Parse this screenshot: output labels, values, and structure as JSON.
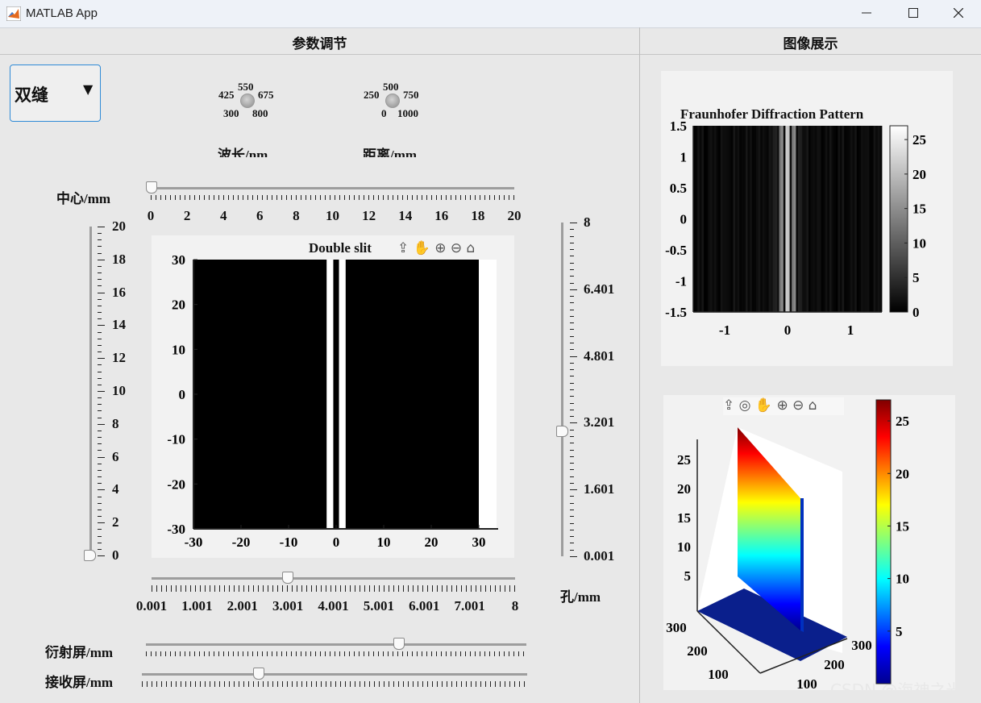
{
  "window": {
    "title": "MATLAB App"
  },
  "panels": {
    "left_title": "参数调节",
    "right_title": "图像展示"
  },
  "dropdown": {
    "value": "双缝"
  },
  "knob_wavelength": {
    "labels": [
      "425",
      "550",
      "675",
      "300",
      "800"
    ],
    "caption": "波长/nm"
  },
  "knob_distance": {
    "labels": [
      "250",
      "500",
      "750",
      "0",
      "1000"
    ],
    "caption": "距离/mm"
  },
  "slider_center": {
    "label": "中心/mm",
    "ticks": [
      "0",
      "2",
      "4",
      "6",
      "8",
      "10",
      "12",
      "14",
      "16",
      "18",
      "20"
    ],
    "value": 0
  },
  "slider_left_vertical": {
    "ticks": [
      "20",
      "18",
      "16",
      "14",
      "12",
      "10",
      "8",
      "6",
      "4",
      "2",
      "0"
    ],
    "value": 0
  },
  "slider_aperture": {
    "label": "孔/mm",
    "ticks": [
      "8",
      "6.401",
      "4.801",
      "3.201",
      "1.601",
      "0.001"
    ],
    "value": 3.2
  },
  "slider_bottom": {
    "ticks": [
      "0.001",
      "1.001",
      "2.001",
      "3.001",
      "4.001",
      "5.001",
      "6.001",
      "7.001",
      "8"
    ],
    "value": 3.0
  },
  "slider_diffraction_screen": {
    "label": "衍射屏/mm",
    "value": 0.67
  },
  "slider_receive_screen": {
    "label": "接收屏/mm",
    "value": 0.3
  },
  "toolbar_icons": [
    "export-icon",
    "pan-hand-icon",
    "zoom-in-icon",
    "zoom-out-icon",
    "home-icon"
  ],
  "chart_data": [
    {
      "type": "heatmap",
      "title": "Double slit",
      "xticks": [
        "-30",
        "-20",
        "-10",
        "0",
        "10",
        "20",
        "30"
      ],
      "yticks": [
        "30",
        "20",
        "10",
        "0",
        "-10",
        "-20",
        "-30"
      ],
      "xlim": [
        -30,
        30
      ],
      "ylim": [
        -30,
        30
      ],
      "slits_x": [
        [
          -2,
          -0.6
        ],
        [
          0.6,
          2
        ]
      ]
    },
    {
      "type": "heatmap",
      "title": "Fraunhofer Diffraction Pattern",
      "xticks": [
        "-1",
        "0",
        "1"
      ],
      "yticks": [
        "1.5",
        "1",
        "0.5",
        "0",
        "-0.5",
        "-1",
        "-1.5"
      ],
      "colorbar_ticks": [
        "25",
        "20",
        "15",
        "10",
        "5",
        "0"
      ],
      "xlim": [
        -1.5,
        1.5
      ],
      "ylim": [
        -1.5,
        1.5
      ],
      "clim": [
        0,
        27
      ],
      "colormap": "gray"
    },
    {
      "type": "surface",
      "zticks": [
        "25",
        "20",
        "15",
        "10",
        "5"
      ],
      "xticks": [
        "300",
        "200",
        "100"
      ],
      "yticks": [
        "300",
        "200",
        "100"
      ],
      "colorbar_ticks": [
        "25",
        "20",
        "15",
        "10",
        "5"
      ],
      "clim": [
        0,
        27
      ],
      "colormap": "jet"
    }
  ],
  "watermark": "CSDN @海神之光"
}
